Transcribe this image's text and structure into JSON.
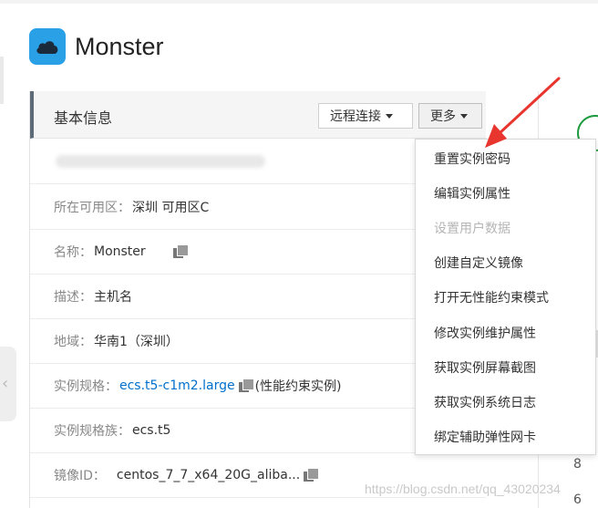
{
  "app": {
    "title": "Monster"
  },
  "panel": {
    "title": "基本信息",
    "remote_button": "远程连接",
    "more_button": "更多"
  },
  "rows": [
    {
      "label": "所在可用区：",
      "value": "深圳 可用区C"
    },
    {
      "label": "名称：",
      "value": "Monster"
    },
    {
      "label": "描述：",
      "value": "主机名"
    },
    {
      "label": "地域：",
      "value": "华南1（深圳）"
    },
    {
      "label": "实例规格：",
      "value": "ecs.t5-c1m2.large",
      "extra": "(性能约束实例)"
    },
    {
      "label": "实例规格族：",
      "value": "ecs.t5"
    },
    {
      "label": "镜像ID：",
      "value": "centos_7_7_x64_20G_aliba..."
    }
  ],
  "menu": {
    "items": [
      {
        "label": "重置实例密码",
        "disabled": false
      },
      {
        "label": "编辑实例属性",
        "disabled": false
      },
      {
        "label": "设置用户数据",
        "disabled": true
      },
      {
        "label": "创建自定义镜像",
        "disabled": false
      },
      {
        "label": "打开无性能约束模式",
        "disabled": false
      },
      {
        "label": "修改实例维护属性",
        "disabled": false
      },
      {
        "label": "获取实例屏幕截图",
        "disabled": false
      },
      {
        "label": "获取实例系统日志",
        "disabled": false
      },
      {
        "label": "绑定辅助弹性网卡",
        "disabled": false
      }
    ]
  },
  "side_numbers": [
    "8",
    "6"
  ],
  "watermark": "https://blog.csdn.net/qq_43020234",
  "colors": {
    "accent": "#0070cc",
    "app_icon": "#2aa0e6",
    "arrow": "#e8352e",
    "status": "#1d9a3e"
  },
  "icons": {
    "app": "cloud-icon",
    "copy": "copy-icon",
    "collapse": "chevron-left-icon"
  }
}
